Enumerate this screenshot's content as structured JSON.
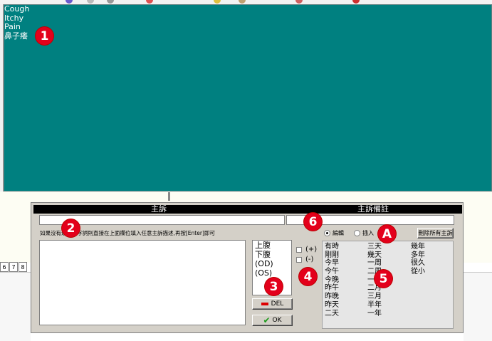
{
  "complaints": [
    "Cough",
    "Itchy",
    "Pain",
    "鼻子癢"
  ],
  "dialog": {
    "header_main": "主訴",
    "header_note": "主訴備註",
    "hint": "如果沒有適合的字詞則直接在上面欄位填入任意主訴描述,再按[Enter]即可",
    "sites": [
      "上腹",
      "下腹",
      "(OD)",
      "(OS)"
    ],
    "del_label": "DEL",
    "ok_label": "OK",
    "check_plus": "(+)",
    "check_minus": "(-)",
    "radio_edit": "編輯",
    "radio_insert": "插入",
    "clear_all_label": "刪除所有主訴",
    "time_col1": [
      "有時",
      "剛剛",
      "今早",
      "今午",
      "今晚",
      "昨午",
      "昨晚",
      "昨天",
      "二天"
    ],
    "time_col2": [
      "三天",
      "幾天",
      "一周",
      "二周",
      "一月",
      "二月",
      "三月",
      "半年",
      "一年"
    ],
    "time_col3": [
      "幾年",
      "多年",
      "很久",
      "從小"
    ]
  },
  "taskbar_numbers": [
    "6",
    "7",
    "8"
  ],
  "badges": [
    "1",
    "2",
    "3",
    "4",
    "5",
    "6",
    "A"
  ],
  "colors": {
    "teal": "#008080",
    "badge": "#e3001b",
    "dialog_bg": "#d4d0c8"
  }
}
